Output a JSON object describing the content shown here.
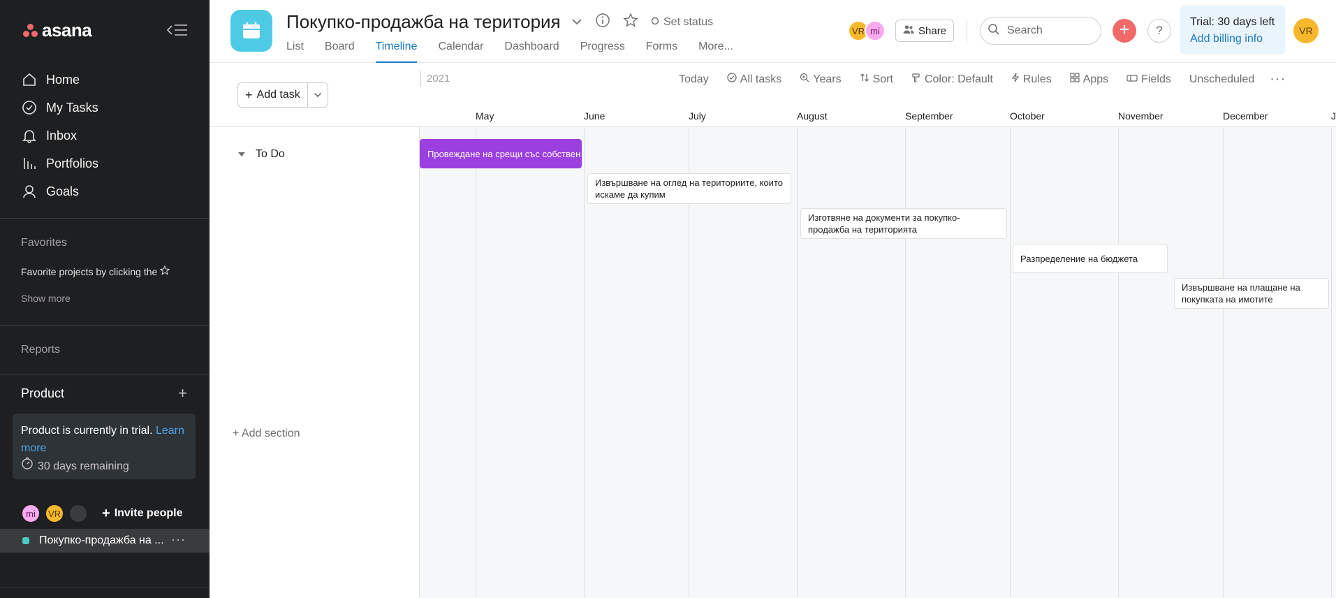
{
  "sidebar": {
    "logo": "asana",
    "nav": [
      {
        "label": "Home",
        "icon": "home-icon"
      },
      {
        "label": "My Tasks",
        "icon": "check-circle-icon"
      },
      {
        "label": "Inbox",
        "icon": "bell-icon"
      },
      {
        "label": "Portfolios",
        "icon": "bar-chart-icon"
      },
      {
        "label": "Goals",
        "icon": "person-icon"
      }
    ],
    "favorites_heading": "Favorites",
    "favorites_hint": "Favorite projects by clicking the",
    "show_more": "Show more",
    "reports_heading": "Reports",
    "team_name": "Product",
    "trial": {
      "text": "Product is currently in trial.",
      "link": "Learn more",
      "days": "30 days remaining"
    },
    "people": [
      "mi",
      "VR",
      ""
    ],
    "invite_label": "Invite people",
    "project_item": "Покупко-продажба на ..."
  },
  "header": {
    "project_title": "Покупко-продажба на територия",
    "set_status": "Set status",
    "tabs": [
      "List",
      "Board",
      "Timeline",
      "Calendar",
      "Dashboard",
      "Progress",
      "Forms",
      "More..."
    ],
    "active_tab": "Timeline",
    "members": [
      "VR",
      "mi"
    ],
    "share_label": "Share",
    "search_placeholder": "Search",
    "trial_line1": "Trial: 30 days left",
    "trial_line2": "Add billing info",
    "user_initials": "VR",
    "accent_color": "#1a7bbf"
  },
  "toolbar": {
    "add_task": "Add task",
    "year": "2021",
    "today": "Today",
    "all_tasks": "All tasks",
    "years": "Years",
    "sort": "Sort",
    "color": "Color: Default",
    "rules": "Rules",
    "apps": "Apps",
    "fields": "Fields",
    "unscheduled": "Unscheduled"
  },
  "timeline": {
    "months": [
      "May",
      "June",
      "July",
      "August",
      "September",
      "October",
      "November",
      "December",
      "Ja"
    ],
    "section": "To Do",
    "add_section": "+ Add section",
    "tasks": [
      {
        "name": "Провеждане на срещи със собственици"
      },
      {
        "name": "Извършване на оглед на териториите, които искаме да купим"
      },
      {
        "name": "Изготвяне на документи за покупко-продажба на територията"
      },
      {
        "name": "Разпределение на бюджета"
      },
      {
        "name": "Извършване на плащане на покупката на имотите"
      }
    ]
  }
}
